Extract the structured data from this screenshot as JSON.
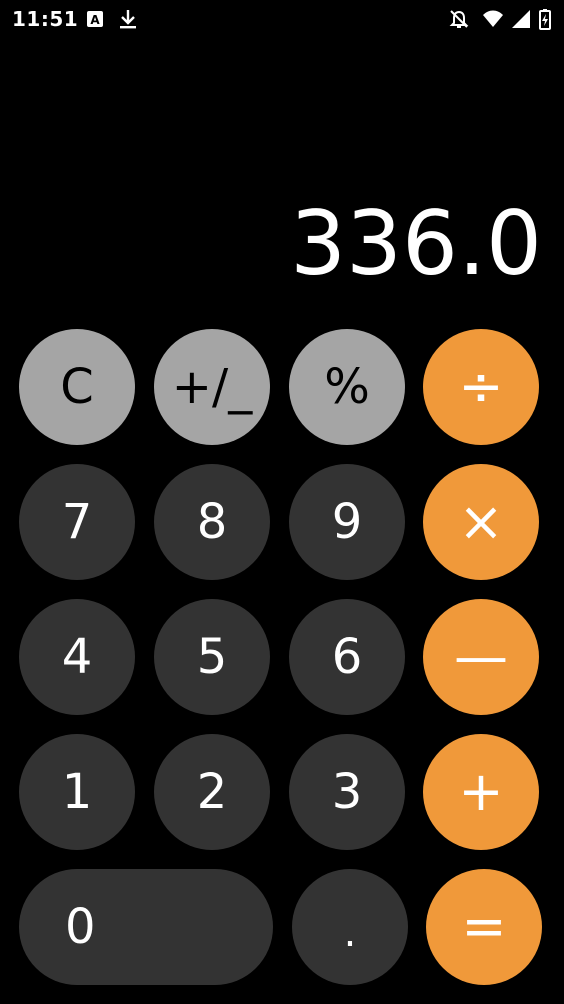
{
  "status_bar": {
    "time": "11:51",
    "icons": [
      "font-app-icon",
      "download-icon",
      "notifications-off-icon",
      "wifi-icon",
      "cellular-signal-icon",
      "battery-charging-icon"
    ]
  },
  "display": {
    "value": "336.0"
  },
  "keys": {
    "clear": "C",
    "sign": "+/_",
    "percent": "%",
    "divide": "÷",
    "seven": "7",
    "eight": "8",
    "nine": "9",
    "multiply": "×",
    "four": "4",
    "five": "5",
    "six": "6",
    "subtract": "—",
    "one": "1",
    "two": "2",
    "three": "3",
    "add": "+",
    "zero": "0",
    "decimal": ".",
    "equals": "="
  },
  "colors": {
    "background": "#000000",
    "function_key": "#a5a5a5",
    "number_key": "#333333",
    "operator_key": "#f0993a"
  }
}
